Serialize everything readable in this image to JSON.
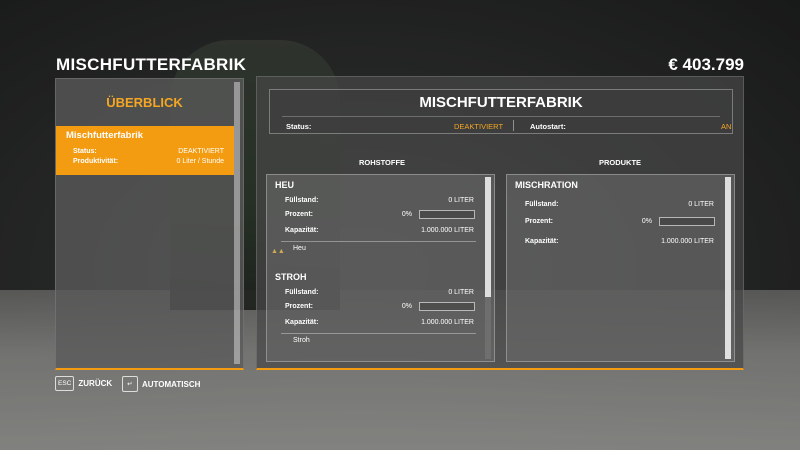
{
  "header": {
    "title": "MISCHFUTTERFABRIK",
    "money": "€ 403.799"
  },
  "sidebar": {
    "tab_title": "ÜBERBLICK",
    "item": {
      "title": "Mischfutterfabrik",
      "status_label": "Status:",
      "status_value": "DEAKTIVIERT",
      "productivity_label": "Produktivität:",
      "productivity_value": "0 Liter / Stunde"
    }
  },
  "main": {
    "title": "MISCHFUTTERFABRIK",
    "status_label": "Status:",
    "status_value": "DEAKTIVIERT",
    "autostart_label": "Autostart:",
    "autostart_value": "AN",
    "inputs_heading": "ROHSTOFFE",
    "outputs_heading": "PRODUKTE",
    "inputs": [
      {
        "name": "HEU",
        "fill_label": "Füllstand:",
        "fill_value": "0 LITER",
        "percent_label": "Prozent:",
        "percent_value": "0%",
        "percent": 0,
        "capacity_label": "Kapazität:",
        "capacity_value": "1.000.000 LITER",
        "filltype": "Heu"
      },
      {
        "name": "STROH",
        "fill_label": "Füllstand:",
        "fill_value": "0 LITER",
        "percent_label": "Prozent:",
        "percent_value": "0%",
        "percent": 0,
        "capacity_label": "Kapazität:",
        "capacity_value": "1.000.000 LITER",
        "filltype": "Stroh"
      }
    ],
    "outputs": [
      {
        "name": "MISCHRATION",
        "fill_label": "Füllstand:",
        "fill_value": "0 LITER",
        "percent_label": "Prozent:",
        "percent_value": "0%",
        "percent": 0,
        "capacity_label": "Kapazität:",
        "capacity_value": "1.000.000 LITER"
      }
    ]
  },
  "footer": {
    "back_key": "ESC",
    "back_label": "ZURÜCK",
    "auto_key": "↵",
    "auto_label": "AUTOMATISCH"
  },
  "colors": {
    "accent": "#f39c12"
  }
}
